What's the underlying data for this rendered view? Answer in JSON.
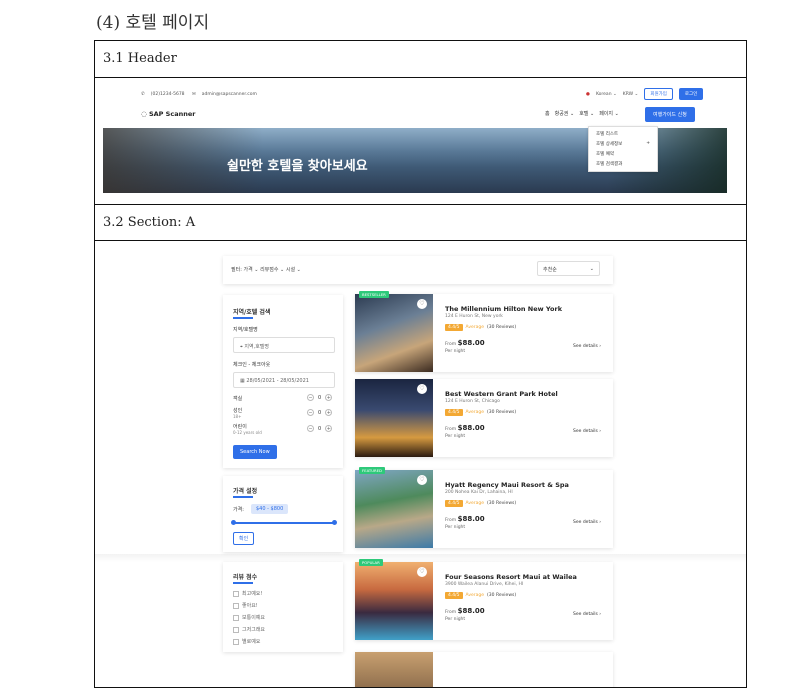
{
  "doc": {
    "title": "(4) 호텔 페이지",
    "section1_label": "3.1 Header",
    "section2_label": "3.2 Section: A"
  },
  "header": {
    "phone": "(02)1234-5678",
    "email": "admin@sapscanner.com",
    "language": "Korean",
    "currency": "KRW",
    "signup": "회원가입",
    "login": "로그인",
    "logo": "SAP Scanner",
    "nav": [
      "홈",
      "항공권",
      "호텔",
      "페이지"
    ],
    "cta": "여행가이드 신청",
    "hero_title": "쉴만한 호텔을 찾아보세요",
    "dropdown": [
      "호텔 리스트",
      "호텔 상세정보",
      "호텔 예약",
      "호텔 검색결과"
    ]
  },
  "filters": {
    "label": "필터:",
    "items": [
      "가격",
      "리뷰점수",
      "시설"
    ],
    "sort": "추천순"
  },
  "search_box": {
    "title": "지역/호텔 검색",
    "region_label": "지역/호텔명",
    "region_placeholder": "지역,호텔명",
    "dates_label": "체크인 - 체크아웃",
    "dates_value": "28/05/2021 - 28/05/2021",
    "rooms_label": "객실",
    "adults_label": "성인",
    "adults_sub": "18+",
    "children_label": "어린이",
    "children_sub": "0-12 years old",
    "count": "0",
    "button": "Search Now"
  },
  "price_box": {
    "title": "가격 설정",
    "label": "가격:",
    "range": "$40 - $800",
    "confirm": "확인"
  },
  "review_box": {
    "title": "리뷰 점수",
    "options": [
      "최고예요!",
      "좋아요!",
      "보통이예요",
      "그저그래요",
      "별로예요"
    ]
  },
  "hotels": [
    {
      "name": "The Millennium Hilton New York",
      "address": "124 E Huron St, New york",
      "badge": "BESTSELLER",
      "rating": "4.4/5",
      "rating_word": "Average",
      "reviews": "(30 Reviews)",
      "from": "From",
      "price": "$88.00",
      "per": "Per night",
      "details": "See details"
    },
    {
      "name": "Best Western Grant Park Hotel",
      "address": "124 E Huron St, Chicago",
      "badge": "",
      "rating": "4.4/5",
      "rating_word": "Average",
      "reviews": "(30 Reviews)",
      "from": "From",
      "price": "$88.00",
      "per": "Per night",
      "details": "See details"
    },
    {
      "name": "Hyatt Regency Maui Resort & Spa",
      "address": "200 Nohea Kai Dr, Lahaina, HI",
      "badge": "FEATURED",
      "rating": "4.4/5",
      "rating_word": "Average",
      "reviews": "(30 Reviews)",
      "from": "From",
      "price": "$88.00",
      "per": "Per night",
      "details": "See details"
    },
    {
      "name": "Four Seasons Resort Maui at Wailea",
      "address": "3900 Wailea Alanui Drive, Kihei, HI",
      "badge": "POPULAR",
      "rating": "4.4/5",
      "rating_word": "Average",
      "reviews": "(30 Reviews)",
      "from": "From",
      "price": "$88.00",
      "per": "Per night",
      "details": "See details"
    }
  ],
  "colors": {
    "accent": "#2f6fe8",
    "rating": "#f3a833",
    "badge": "#2ec97a"
  }
}
